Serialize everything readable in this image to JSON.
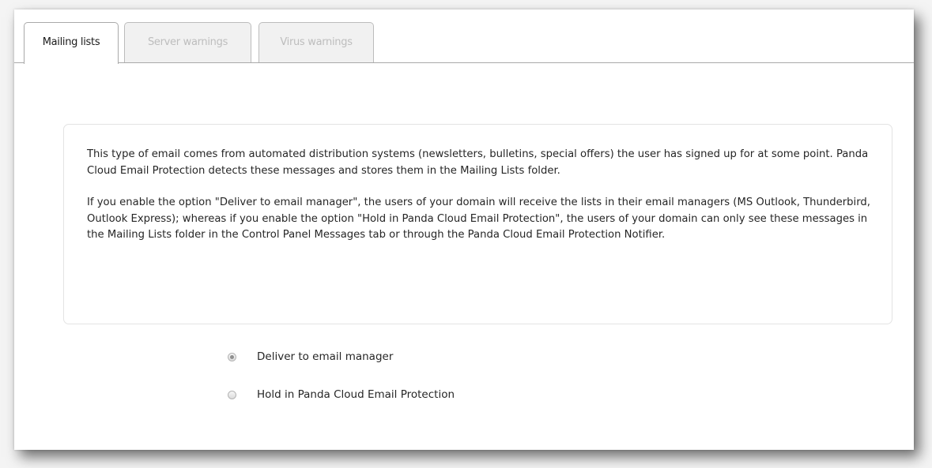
{
  "tabs": [
    {
      "label": "Mailing lists",
      "active": true
    },
    {
      "label": "Server warnings",
      "active": false
    },
    {
      "label": "Virus warnings",
      "active": false
    }
  ],
  "info": {
    "paragraph1": "This type of email comes from automated distribution systems (newsletters, bulletins, special offers) the user has signed up for at some point. Panda Cloud Email Protection detects these messages and stores them in the Mailing Lists folder.",
    "paragraph2": "If you enable the option \"Deliver to email manager\", the users of your domain will receive the lists in their email managers (MS Outlook, Thunderbird, Outlook Express); whereas if you enable the option \"Hold in Panda Cloud Email Protection\", the users of your domain can only see these messages in the Mailing Lists folder in the Control Panel Messages tab or through the Panda Cloud Email Protection Notifier."
  },
  "options": [
    {
      "label": "Deliver to email manager",
      "selected": true
    },
    {
      "label": "Hold in Panda Cloud Email Protection",
      "selected": false
    }
  ],
  "colors": {
    "active_tab_text": "#1b1b1b",
    "inactive_tab_text": "#bdbdbd",
    "body_text": "#262626"
  }
}
